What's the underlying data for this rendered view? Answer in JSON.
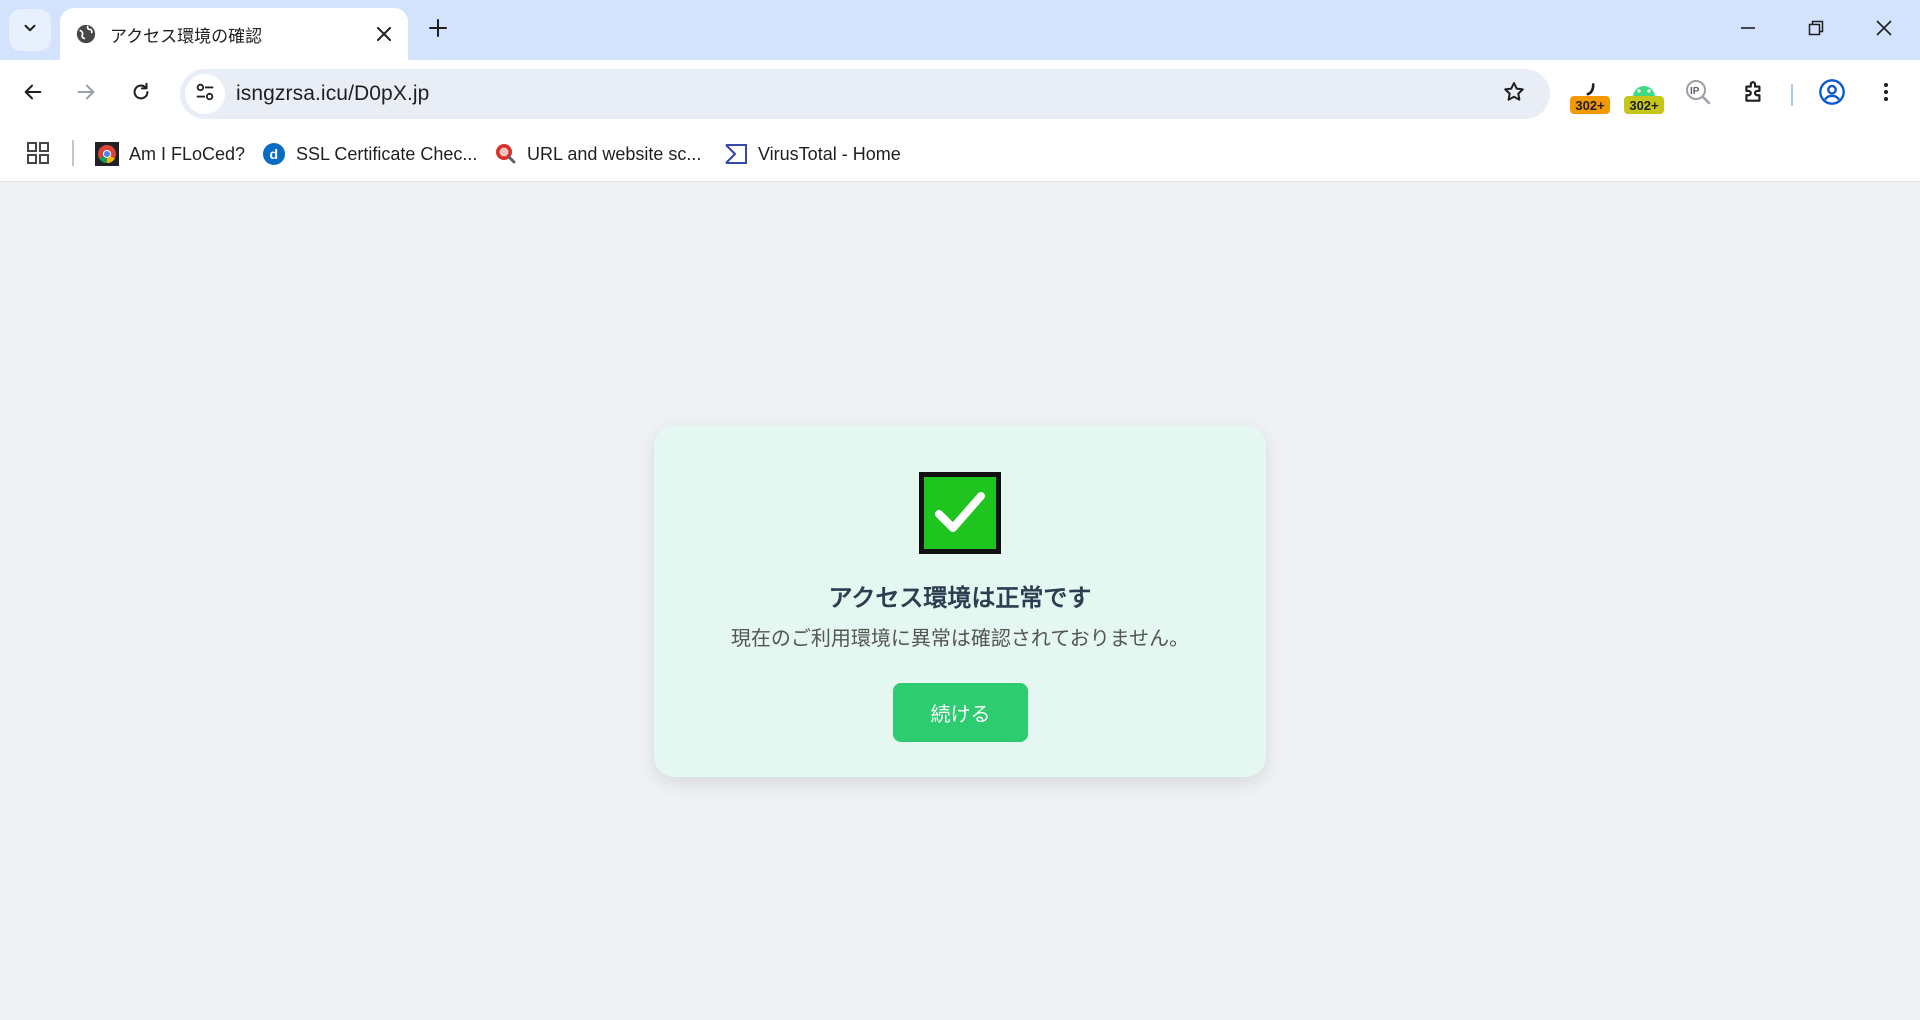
{
  "tab": {
    "title": "アクセス環境の確認"
  },
  "toolbar": {
    "url": "isngzrsa.icu/D0pX.jp",
    "extensions": [
      {
        "name": "redirect-extension",
        "badge": "302+",
        "badge_color": "#f29900"
      },
      {
        "name": "redirect-extension-2",
        "badge": "302+",
        "badge_color": "#c5c51a"
      }
    ]
  },
  "bookmarks": [
    {
      "label": "Am I FLoCed?",
      "icon": "chrome-icon"
    },
    {
      "label": "SSL Certificate Chec...",
      "icon": "digicert-icon"
    },
    {
      "label": "URL and website sc...",
      "icon": "urlscan-icon"
    },
    {
      "label": "VirusTotal - Home",
      "icon": "virustotal-icon"
    }
  ],
  "card": {
    "title": "アクセス環境は正常です",
    "message": "現在のご利用環境に異常は確認されておりません。",
    "button_label": "続ける",
    "accent_color": "#2ecc71",
    "check_color": "#1fc41f"
  }
}
